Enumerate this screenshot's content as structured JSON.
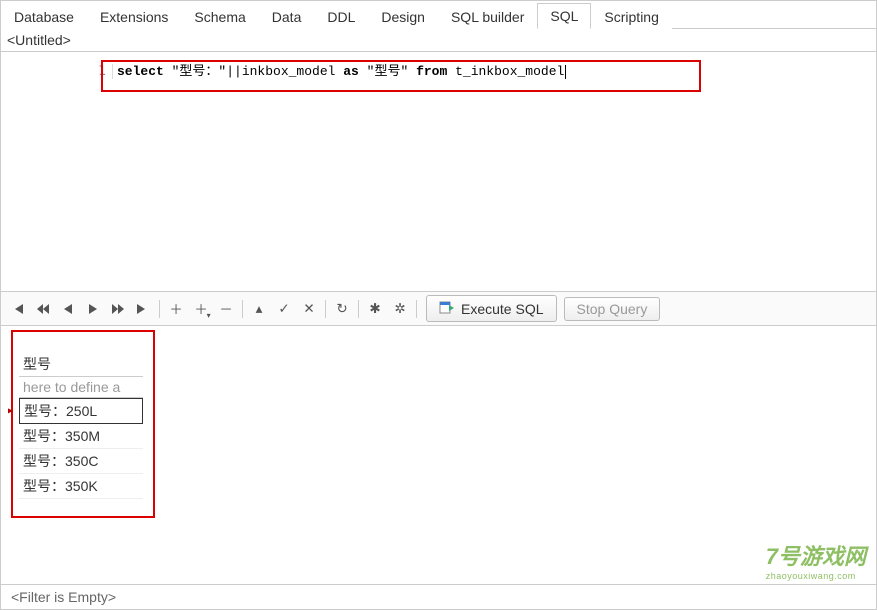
{
  "tabs": [
    {
      "label": "Database"
    },
    {
      "label": "Extensions"
    },
    {
      "label": "Schema"
    },
    {
      "label": "Data"
    },
    {
      "label": "DDL"
    },
    {
      "label": "Design"
    },
    {
      "label": "SQL builder"
    },
    {
      "label": "SQL",
      "active": true
    },
    {
      "label": "Scripting"
    }
  ],
  "title": "<Untitled>",
  "editor": {
    "line_number": "1",
    "kw_select": "select",
    "frag1": " \"型号：\"||inkbox_model ",
    "kw_as": "as",
    "frag2": " \"型号\" ",
    "kw_from": "from",
    "frag3": " t_inkbox_model"
  },
  "toolbar": {
    "execute_label": "Execute SQL",
    "stop_label": "Stop Query"
  },
  "results": {
    "column_header": "型号",
    "filter_hint": "here to define a",
    "rows": [
      {
        "value": "型号：250L",
        "selected": true
      },
      {
        "value": "型号：350M"
      },
      {
        "value": "型号：350C"
      },
      {
        "value": "型号：350K"
      }
    ]
  },
  "footer": "<Filter is Empty>",
  "watermark": {
    "main": "7号游戏网",
    "sub": "zhaoyouxiwang.com"
  }
}
